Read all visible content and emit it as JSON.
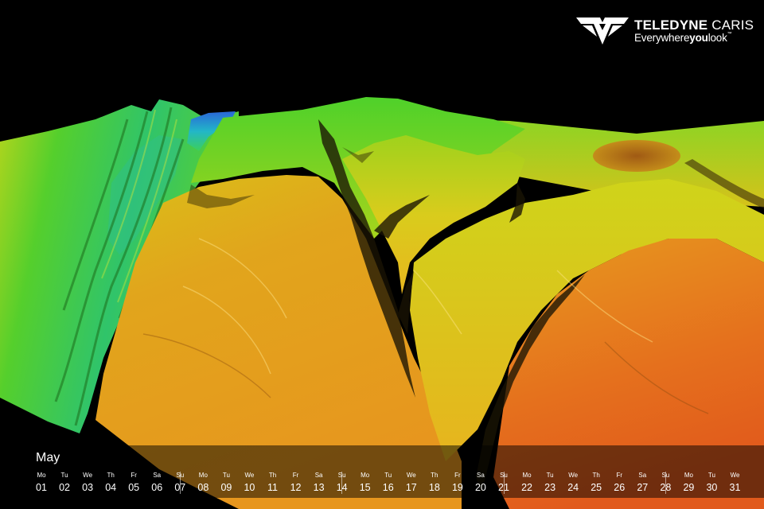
{
  "logo": {
    "brand_bold": "TELEDYNE",
    "brand_light": "CARIS",
    "tagline_pre": "Everywhere",
    "tagline_bold": "you",
    "tagline_post": "look",
    "trademark": "™",
    "icon": "teledyne-chevron-logo"
  },
  "scene": {
    "description_colors": [
      "#3a7bd5",
      "#22c4b0",
      "#4ccf2a",
      "#b8d61a",
      "#e6b81c",
      "#e88a1e",
      "#e0561c"
    ]
  },
  "calendar": {
    "month": "May",
    "days": [
      {
        "dn": "Mo",
        "dd": "01"
      },
      {
        "dn": "Tu",
        "dd": "02"
      },
      {
        "dn": "We",
        "dd": "03"
      },
      {
        "dn": "Th",
        "dd": "04"
      },
      {
        "dn": "Fr",
        "dd": "05"
      },
      {
        "dn": "Sa",
        "dd": "06"
      },
      {
        "dn": "Su",
        "dd": "07"
      },
      {
        "dn": "Mo",
        "dd": "08"
      },
      {
        "dn": "Tu",
        "dd": "09"
      },
      {
        "dn": "We",
        "dd": "10"
      },
      {
        "dn": "Th",
        "dd": "11"
      },
      {
        "dn": "Fr",
        "dd": "12"
      },
      {
        "dn": "Sa",
        "dd": "13"
      },
      {
        "dn": "Su",
        "dd": "14"
      },
      {
        "dn": "Mo",
        "dd": "15"
      },
      {
        "dn": "Tu",
        "dd": "16"
      },
      {
        "dn": "We",
        "dd": "17"
      },
      {
        "dn": "Th",
        "dd": "18"
      },
      {
        "dn": "Fr",
        "dd": "19"
      },
      {
        "dn": "Sa",
        "dd": "20"
      },
      {
        "dn": "Su",
        "dd": "21"
      },
      {
        "dn": "Mo",
        "dd": "22"
      },
      {
        "dn": "Tu",
        "dd": "23"
      },
      {
        "dn": "We",
        "dd": "24"
      },
      {
        "dn": "Th",
        "dd": "25"
      },
      {
        "dn": "Fr",
        "dd": "26"
      },
      {
        "dn": "Sa",
        "dd": "27"
      },
      {
        "dn": "Su",
        "dd": "28"
      },
      {
        "dn": "Mo",
        "dd": "29"
      },
      {
        "dn": "Tu",
        "dd": "30"
      },
      {
        "dn": "We",
        "dd": "31"
      }
    ]
  }
}
